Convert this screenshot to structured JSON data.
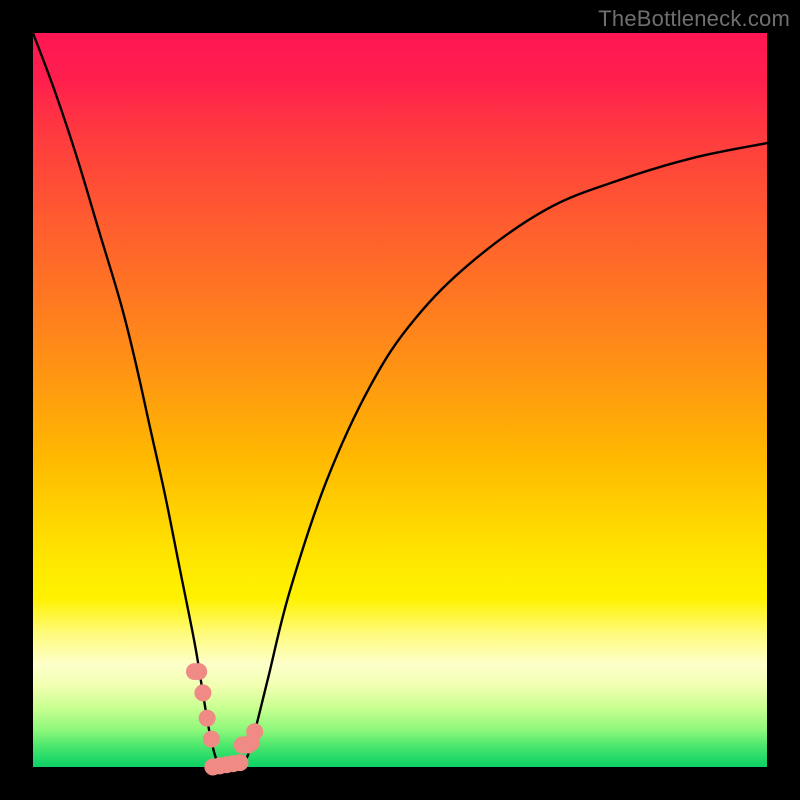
{
  "watermark": "TheBottleneck.com",
  "chart_data": {
    "type": "line",
    "title": "",
    "xlabel": "",
    "ylabel": "",
    "xlim": [
      0,
      100
    ],
    "ylim": [
      0,
      100
    ],
    "series": [
      {
        "name": "bottleneck-curve",
        "x": [
          0,
          3,
          6,
          9,
          12,
          14,
          16,
          18,
          20,
          22,
          23,
          24,
          25,
          26,
          27,
          28,
          29,
          30,
          32,
          35,
          40,
          46,
          52,
          60,
          70,
          80,
          90,
          100
        ],
        "values": [
          100,
          92,
          83,
          73,
          63,
          55,
          46,
          37,
          27,
          17,
          11,
          5,
          1,
          0,
          0,
          0,
          1,
          4,
          12,
          24,
          39,
          52,
          61,
          69,
          76,
          80,
          83,
          85
        ]
      }
    ],
    "highlight_segments": [
      {
        "name": "left-dots-cluster",
        "x_range": [
          22.0,
          24.3
        ],
        "y_range": [
          1.0,
          13.0
        ]
      },
      {
        "name": "right-dots-cluster",
        "x_range": [
          28.5,
          30.2
        ],
        "y_range": [
          3.0,
          11.0
        ]
      },
      {
        "name": "bottom-dots-line",
        "x_range": [
          24.5,
          28.2
        ],
        "y_range": [
          0.0,
          0.6
        ]
      }
    ],
    "colors": {
      "curve": "#000000",
      "highlight": "#ef8a84",
      "gradient_top": "#ff1653",
      "gradient_bottom": "#0fd066",
      "frame": "#000000",
      "watermark": "#6f6f6f"
    }
  }
}
